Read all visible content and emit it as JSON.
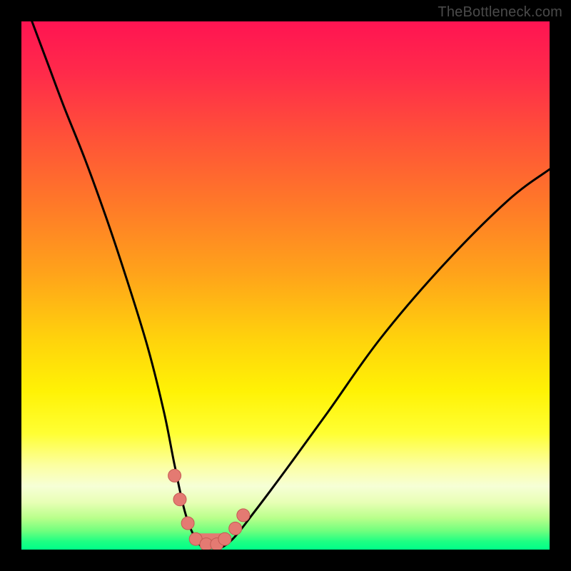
{
  "watermark": "TheBottleneck.com",
  "colors": {
    "frame": "#000000",
    "gradient_stops": [
      {
        "offset": 0.0,
        "color": "#ff1452"
      },
      {
        "offset": 0.1,
        "color": "#ff2b4a"
      },
      {
        "offset": 0.22,
        "color": "#ff5238"
      },
      {
        "offset": 0.35,
        "color": "#ff7a28"
      },
      {
        "offset": 0.48,
        "color": "#ffa41a"
      },
      {
        "offset": 0.6,
        "color": "#ffd20c"
      },
      {
        "offset": 0.7,
        "color": "#fff205"
      },
      {
        "offset": 0.78,
        "color": "#ffff33"
      },
      {
        "offset": 0.84,
        "color": "#fcffa1"
      },
      {
        "offset": 0.88,
        "color": "#f6ffd6"
      },
      {
        "offset": 0.91,
        "color": "#e8ffb6"
      },
      {
        "offset": 0.94,
        "color": "#b9ff8b"
      },
      {
        "offset": 0.965,
        "color": "#6fff7e"
      },
      {
        "offset": 0.985,
        "color": "#1dff83"
      },
      {
        "offset": 1.0,
        "color": "#00ff88"
      }
    ],
    "curve": "#000000",
    "marker_fill": "#e47a72",
    "marker_stroke": "#c45a54"
  },
  "chart_data": {
    "type": "line",
    "title": "",
    "xlabel": "",
    "ylabel": "",
    "xlim": [
      0,
      100
    ],
    "ylim": [
      0,
      100
    ],
    "series": [
      {
        "name": "bottleneck-curve",
        "x": [
          2,
          5,
          8,
          12,
          16,
          20,
          24,
          27,
          29,
          31,
          33,
          35,
          37,
          40,
          44,
          50,
          58,
          68,
          80,
          92,
          100
        ],
        "values": [
          100,
          92,
          84,
          74,
          63,
          51,
          38,
          26,
          16,
          7,
          2,
          0,
          0,
          2,
          7,
          15,
          26,
          40,
          54,
          66,
          72
        ]
      }
    ],
    "markers": {
      "x": [
        29.0,
        30.0,
        31.5,
        33.0,
        35.0,
        37.0,
        38.5,
        40.5,
        42.0
      ],
      "values": [
        14.0,
        9.5,
        5.0,
        2.0,
        1.0,
        1.0,
        2.0,
        4.0,
        6.5
      ]
    },
    "annotations": []
  }
}
